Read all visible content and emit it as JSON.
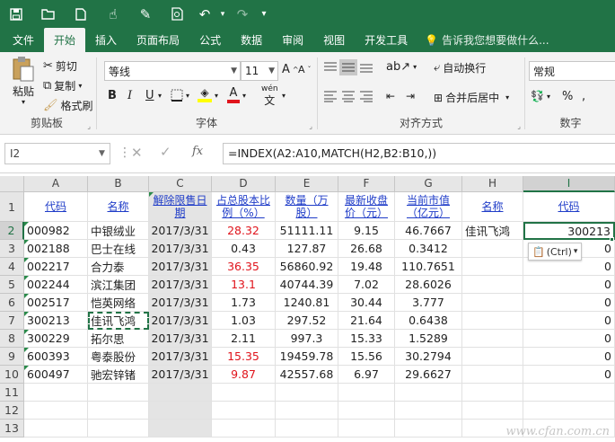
{
  "qat": {
    "items": [
      "save-icon",
      "open-icon",
      "new-icon",
      "touch-icon",
      "format-painter-icon",
      "print-preview-icon",
      "undo-icon",
      "undo-dropdown-icon",
      "redo-icon",
      "customize-icon"
    ]
  },
  "tabs": [
    {
      "label": "文件",
      "active": false
    },
    {
      "label": "开始",
      "active": true
    },
    {
      "label": "插入",
      "active": false
    },
    {
      "label": "页面布局",
      "active": false
    },
    {
      "label": "公式",
      "active": false
    },
    {
      "label": "数据",
      "active": false
    },
    {
      "label": "审阅",
      "active": false
    },
    {
      "label": "视图",
      "active": false
    },
    {
      "label": "开发工具",
      "active": false
    }
  ],
  "tell_me": "告诉我您想要做什么...",
  "ribbon": {
    "clipboard": {
      "label": "剪贴板",
      "paste": "粘贴",
      "cut": "剪切",
      "copy": "复制",
      "format_painter": "格式刷"
    },
    "font": {
      "label": "字体",
      "name": "等线",
      "size": "11",
      "bold": "B",
      "italic": "I",
      "underline": "U",
      "phonetic": "wén"
    },
    "align": {
      "label": "对齐方式",
      "wrap": "自动换行",
      "merge": "合并后居中"
    },
    "number": {
      "label": "数字",
      "format": "常规"
    }
  },
  "formula_bar": {
    "name_box": "I2",
    "formula": "=INDEX(A2:A10,MATCH(H2,B2:B10,))"
  },
  "columns": [
    "A",
    "B",
    "C",
    "D",
    "E",
    "F",
    "G",
    "H",
    "I"
  ],
  "headers": [
    "代码",
    "名称",
    "解除限售日期",
    "占总股本比例（%）",
    "数量（万股）",
    "最新收盘价（元）",
    "当前市值（亿元）",
    "名称",
    "代码"
  ],
  "rows": [
    {
      "a": "000982",
      "b": "中银绒业",
      "c": "2017/3/31",
      "d": "28.32",
      "e": "51111.11",
      "f": "9.15",
      "g": "46.7667"
    },
    {
      "a": "002188",
      "b": "巴士在线",
      "c": "2017/3/31",
      "d": "0.43",
      "e": "127.87",
      "f": "26.68",
      "g": "0.3412"
    },
    {
      "a": "002217",
      "b": "合力泰",
      "c": "2017/3/31",
      "d": "36.35",
      "e": "56860.92",
      "f": "19.48",
      "g": "110.7651"
    },
    {
      "a": "002244",
      "b": "滨江集团",
      "c": "2017/3/31",
      "d": "13.1",
      "e": "40744.39",
      "f": "7.02",
      "g": "28.6026"
    },
    {
      "a": "002517",
      "b": "恺英网络",
      "c": "2017/3/31",
      "d": "1.73",
      "e": "1240.81",
      "f": "30.44",
      "g": "3.777"
    },
    {
      "a": "300213",
      "b": "佳讯飞鸿",
      "c": "2017/3/31",
      "d": "1.03",
      "e": "297.52",
      "f": "21.64",
      "g": "0.6438"
    },
    {
      "a": "300229",
      "b": "拓尔思",
      "c": "2017/3/31",
      "d": "2.11",
      "e": "997.3",
      "f": "15.33",
      "g": "1.5289"
    },
    {
      "a": "600393",
      "b": "粤泰股份",
      "c": "2017/3/31",
      "d": "15.35",
      "e": "19459.78",
      "f": "15.56",
      "g": "30.2794"
    },
    {
      "a": "600497",
      "b": "驰宏锌锗",
      "c": "2017/3/31",
      "d": "9.87",
      "e": "42557.68",
      "f": "6.97",
      "g": "29.6627"
    }
  ],
  "lookup": {
    "name": "佳讯飞鸿",
    "result": "300213",
    "zeros": [
      "0",
      "0",
      "0",
      "0",
      "0",
      "0",
      "0",
      "0"
    ]
  },
  "row_numbers": [
    "1",
    "2",
    "3",
    "4",
    "5",
    "6",
    "7",
    "8",
    "9",
    "10",
    "11",
    "12",
    "13"
  ],
  "paste_options": "(Ctrl)",
  "watermark": "www.cfan.com.cn",
  "colors": {
    "accent": "#217346",
    "red_value": "#e0141c",
    "link": "#1f3cc8"
  }
}
